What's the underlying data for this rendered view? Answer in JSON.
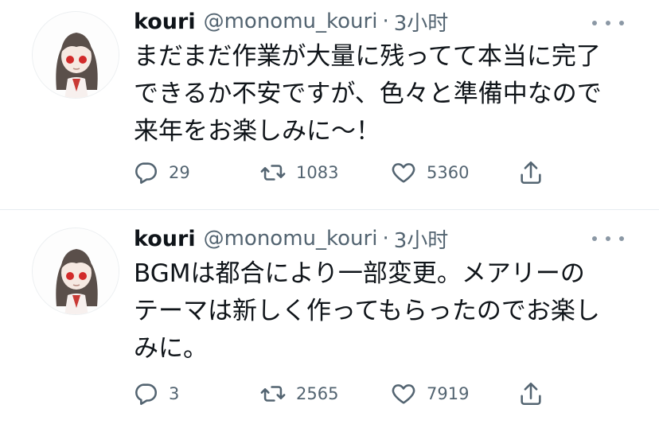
{
  "tweets": [
    {
      "author_name": "kouri",
      "author_handle": "@monomu_kouri",
      "separator": "·",
      "time": "3小时",
      "text": "まだまだ作業が大量に残ってて本当に完了\nできるか不安ですが、色々と準備中なので\n来年をお楽しみに〜！",
      "replies": "29",
      "retweets": "1083",
      "likes": "5360"
    },
    {
      "author_name": "kouri",
      "author_handle": "@monomu_kouri",
      "separator": "·",
      "time": "3小时",
      "text": "BGMは都合により一部変更。メアリーの\nテーマは新しく作ってもらったのでお楽し\nみに。",
      "replies": "3",
      "retweets": "2565",
      "likes": "7919"
    }
  ],
  "icons": {
    "reply": "reply-icon",
    "retweet": "retweet-icon",
    "like": "like-icon",
    "share": "share-icon",
    "more": "more-icon"
  },
  "colors": {
    "text": "#0f1419",
    "secondary": "#536471",
    "divider": "#e6ecf0"
  }
}
